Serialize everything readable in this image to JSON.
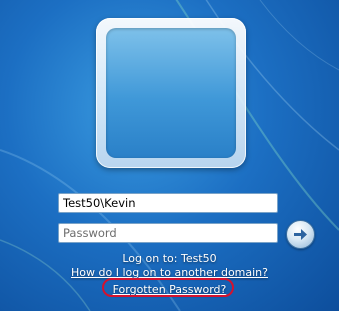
{
  "login": {
    "username_value": "Test50\\Kevin",
    "password_placeholder": "Password",
    "logon_to": "Log on to: Test50",
    "other_domain_link": "How do I log on to another domain?",
    "forgot_password_link": "Forgotten Password?"
  },
  "icons": {
    "go": "arrow-right-icon",
    "avatar": "user-avatar-frame"
  },
  "colors": {
    "background": "#1c6fc3",
    "highlight": "#d4122e",
    "text": "#ffffff"
  }
}
